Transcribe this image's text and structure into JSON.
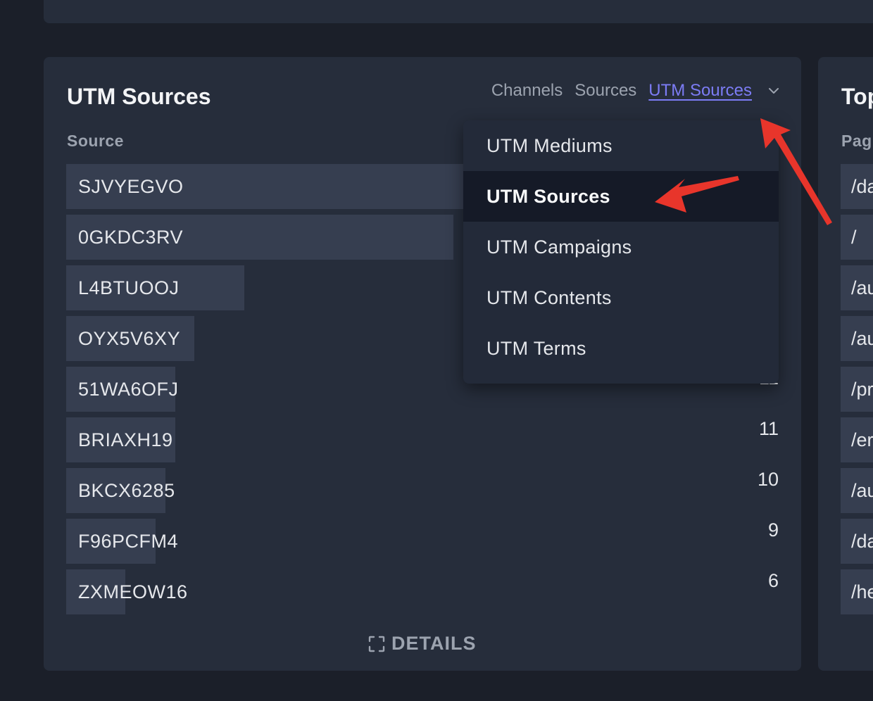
{
  "utm_card": {
    "title": "UTM Sources",
    "column_header": "Source",
    "tabs": [
      "Channels",
      "Sources",
      "UTM Sources"
    ],
    "active_tab": "UTM Sources",
    "rows": [
      {
        "label": "SJVYEGVO",
        "count": "",
        "fraction": 0.56
      },
      {
        "label": "0GKDC3RV",
        "count": "",
        "fraction": 0.543
      },
      {
        "label": "L4BTUOOJ",
        "count": "",
        "fraction": 0.25
      },
      {
        "label": "OYX5V6XY",
        "count": "",
        "fraction": 0.18
      },
      {
        "label": "51WA6OFJ",
        "count": "11",
        "fraction": 0.153
      },
      {
        "label": "BRIAXH19",
        "count": "11",
        "fraction": 0.153
      },
      {
        "label": "BKCX6285",
        "count": "10",
        "fraction": 0.139
      },
      {
        "label": "F96PCFM4",
        "count": "9",
        "fraction": 0.125
      },
      {
        "label": "ZXMEOW16",
        "count": "6",
        "fraction": 0.083
      }
    ],
    "details_label": "DETAILS"
  },
  "dropdown": {
    "items": [
      "UTM Mediums",
      "UTM Sources",
      "UTM Campaigns",
      "UTM Contents",
      "UTM Terms"
    ],
    "selected": "UTM Sources"
  },
  "pages_card": {
    "title": "Top",
    "column_header": "Pag",
    "rows": [
      "/da",
      "/",
      "/au",
      "/au",
      "/pr",
      "/er",
      "/au",
      "/da",
      "/he"
    ]
  },
  "colors": {
    "background": "#1b1f29",
    "card": "#262d3b",
    "bar": "#363e50",
    "accent": "#7c7cf5",
    "annotation_arrow": "#e8352b"
  },
  "icons": [
    "chevron-down-icon",
    "expand-icon"
  ]
}
